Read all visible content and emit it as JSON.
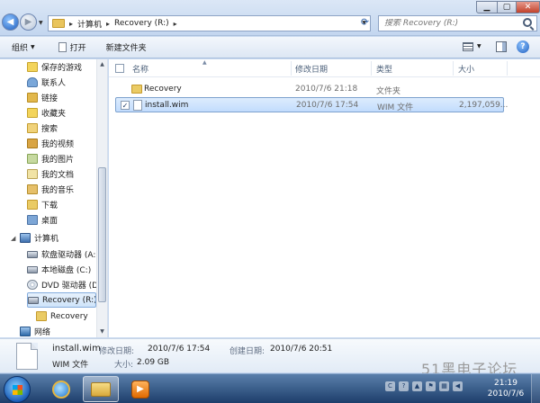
{
  "address": {
    "breadcrumbs": [
      "计算机",
      "Recovery (R:)"
    ]
  },
  "search": {
    "placeholder": "搜索 Recovery (R:)"
  },
  "toolbar": {
    "organize_label": "组织",
    "open_label": "打开",
    "new_folder_label": "新建文件夹"
  },
  "nav": {
    "items": [
      {
        "label": "保存的游戏",
        "icon": "saved-games-icon"
      },
      {
        "label": "联系人",
        "icon": "contacts-icon"
      },
      {
        "label": "链接",
        "icon": "links-icon"
      },
      {
        "label": "收藏夹",
        "icon": "favorites-icon"
      },
      {
        "label": "搜索",
        "icon": "searches-icon"
      },
      {
        "label": "我的视频",
        "icon": "videos-icon"
      },
      {
        "label": "我的图片",
        "icon": "pictures-icon"
      },
      {
        "label": "我的文档",
        "icon": "documents-icon"
      },
      {
        "label": "我的音乐",
        "icon": "music-icon"
      },
      {
        "label": "下载",
        "icon": "downloads-icon"
      },
      {
        "label": "桌面",
        "icon": "desktop-icon"
      },
      {
        "label": "计算机",
        "icon": "computer-icon"
      },
      {
        "label": "软盘驱动器 (A:)",
        "icon": "floppy-drive-icon"
      },
      {
        "label": "本地磁盘 (C:)",
        "icon": "local-disk-icon"
      },
      {
        "label": "DVD 驱动器 (D:)",
        "icon": "dvd-drive-icon"
      },
      {
        "label": "Recovery (R:)",
        "icon": "recovery-drive-icon"
      },
      {
        "label": "Recovery",
        "icon": "folder-icon"
      },
      {
        "label": "网络",
        "icon": "network-icon"
      }
    ]
  },
  "columns": {
    "name": "名称",
    "modified": "修改日期",
    "type": "类型",
    "size": "大小"
  },
  "files": [
    {
      "name": "Recovery",
      "modified": "2010/7/6 21:18",
      "type": "文件夹",
      "size": "",
      "checked": false
    },
    {
      "name": "install.wim",
      "modified": "2010/7/6 17:54",
      "type": "WIM 文件",
      "size": "2,197,059...",
      "checked": true
    }
  ],
  "details": {
    "filename": "install.wim",
    "filetype": "WIM 文件",
    "modified_label": "修改日期:",
    "modified_value": "2010/7/6 17:54",
    "created_label": "创建日期:",
    "created_value": "2010/7/6 20:51",
    "size_label": "大小:",
    "size_value": "2.09 GB"
  },
  "watermark": "51黑电子论坛",
  "taskbar": {
    "time": "21:19",
    "date": "2010/7/6"
  },
  "colors": {
    "selection": "#cfe4fa",
    "taskbar": "#1d3e6b",
    "close_button": "#c2422c"
  }
}
